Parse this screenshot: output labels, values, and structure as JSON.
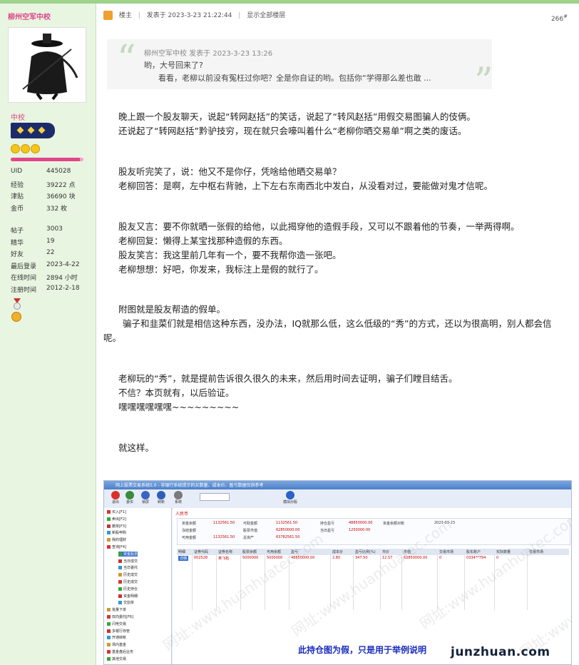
{
  "sidebar": {
    "username": "柳州空军中校",
    "rank": "中校",
    "stats_a": [
      {
        "k": "UID",
        "v": "445028"
      },
      {
        "k": "经验",
        "v": "39222 点"
      },
      {
        "k": "津贴",
        "v": "36690 块"
      },
      {
        "k": "金币",
        "v": "332 枚"
      }
    ],
    "stats_b": [
      {
        "k": "帖子",
        "v": "3003"
      },
      {
        "k": "精华",
        "v": "19"
      },
      {
        "k": "好友",
        "v": "22"
      },
      {
        "k": "最后登录",
        "v": "2023-4-22"
      },
      {
        "k": "在线时间",
        "v": "2894 小时"
      },
      {
        "k": "注册时间",
        "v": "2012-2-18"
      }
    ],
    "level_fraction": 0.95
  },
  "post": {
    "role": "楼主",
    "sep": "|",
    "posted": "发表于 2023-3-23 21:22:44",
    "show_all": "显示全部楼层",
    "floor": "266",
    "floor_mark": "#",
    "quote": {
      "head": "柳州空军中校 发表于 2023-3-23 13:26",
      "line1": "哟，大号回来了?",
      "line2": "看看，老柳以前没有冤枉过你吧？全是你自证的哟。包括你“学得那么差也敢 ..."
    },
    "paragraphs": [
      "晚上跟一个股友聊天，说起“转网赵括”的笑话，说起了“转风赵括”用假交易图骗人的伎俩。",
      "还说起了“转网赵括”黔驴技穷，现在就只会嚎叫着什么“老柳你晒交易单”啊之类的废话。",
      "股友听完笑了，说：他又不是你仔，凭啥给他晒交易单？",
      "老柳回答：是啊，左中枢右背驰，上下左右东南西北中发白，从没看对过，要能做对鬼才信呢。",
      "股友又言：要不你就晒一张假的给他，以此揭穿他的造假手段，又可以不跟着他的节奏，一举两得啊。",
      "老柳回复：懒得上某宝找那种造假的东西。",
      "股友笑言：我这里前几年有一个，要不我帮你造一张吧。",
      "老柳想想：好吧，你发来，我标注上是假的就行了。",
      "附图就是股友帮造的假单。",
      "骗子和韭菜们就是相信这种东西，没办法，IQ就那么低，这么低级的“秀”的方式，还以为很高明，别人都会信呢。",
      "老柳玩的“秀”，就是提前告诉很久很久的未来，然后用时间去证明，骗子们瞠目结舌。",
      "不信？本页就有，以后验证。",
      "嘿嘿嘿嘿嘿嘿~~~~~~~~~",
      "就这样。"
    ]
  },
  "screenshot": {
    "window_title": "网上股票交易系统5.0 - 非银行系统提示的买数量、成本价、盈亏数据仅供参考",
    "toolbar": [
      {
        "label": "退出",
        "icon": "exit-icon",
        "color": "#d9302c"
      },
      {
        "label": "委买",
        "icon": "buy-icon",
        "color": "#3b8b3b"
      },
      {
        "label": "锁屏",
        "icon": "lock-icon",
        "color": "#3a66c0"
      },
      {
        "label": "刷新",
        "icon": "refresh-icon",
        "color": "#2c5fb8"
      },
      {
        "label": "系统",
        "icon": "tools-icon",
        "color": "#7a7a7a"
      },
      {
        "label": "模拟炒股",
        "icon": "user-icon",
        "color": "#2c62c7"
      }
    ],
    "tree": [
      "买入[F1]",
      "卖出[F2]",
      "撤单[F3]",
      "新股申购",
      "我的理财",
      "查询[F4]",
      "资金股票",
      "当日成交",
      "当日委托",
      "历史成交",
      "历史成交",
      "历史持仓",
      "资金明细",
      "交割单",
      "批量下单",
      "双向委托[F6]",
      "闪电交易",
      "多银行存管",
      "开通转账",
      "场内基金",
      "基金盘后业务",
      "其他交易"
    ],
    "tree_selected": 6,
    "tab": "人民币",
    "account": {
      "c1": [
        [
          "资金余额",
          "1132561.50"
        ],
        [
          "冻结金额",
          ""
        ],
        [
          "可用金额",
          "1132561.50"
        ]
      ],
      "c2": [
        [
          "可取金额",
          "1132561.50"
        ],
        [
          "股票市值",
          "62850000.00"
        ],
        [
          "总资产",
          "63782561.50"
        ]
      ],
      "c3": [
        [
          "持仓盈亏",
          "48850000.00"
        ],
        [
          "当日盈亏",
          "1250000.00"
        ]
      ],
      "note": "资金余额对账",
      "date": "2023-03-23"
    },
    "columns": [
      "明细",
      "证券代码",
      "证券名称",
      "股票余额",
      "可用余额",
      "盈亏",
      "成本价",
      "盈亏比例(%)",
      "市价",
      "市值",
      "交易市场",
      "股东账户",
      "实际数量",
      "交易市场"
    ],
    "row": [
      "详细",
      "002528",
      "英飞拓",
      "5000000",
      "5000000",
      "48850000.00",
      "2.80",
      "347.50",
      "12.57",
      "62850000.00",
      "0",
      "0334**794",
      "0",
      ""
    ],
    "watermark": "网址:www.huanhuatec.com",
    "caption": "此持仓图为假，只是用于举例说明"
  },
  "brand": "junzhuan.com"
}
